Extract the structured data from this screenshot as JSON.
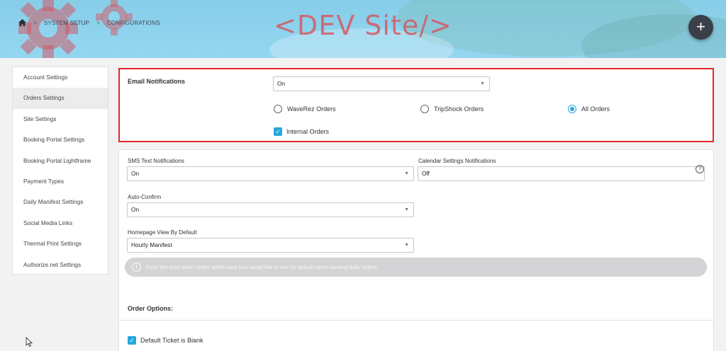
{
  "header": {
    "breadcrumb": [
      "SYSTEM SETUP",
      "CONFIGURATIONS"
    ],
    "dev_title": "<DEV Site/>",
    "add_label": "+"
  },
  "sidebar": {
    "items": [
      {
        "label": "Account Settings"
      },
      {
        "label": "Orders Settings"
      },
      {
        "label": "Site Settings"
      },
      {
        "label": "Booking Portal Settings"
      },
      {
        "label": "Booking Portal Lightframe"
      },
      {
        "label": "Payment Types"
      },
      {
        "label": "Daily Manifest Settings"
      },
      {
        "label": "Social Media Links"
      },
      {
        "label": "Thermal Print Settings"
      },
      {
        "label": "Authorize.net Settings"
      }
    ],
    "active": "Orders Settings"
  },
  "email": {
    "label": "Email Notifications",
    "value": "On",
    "radios": [
      {
        "label": "WaveRez Orders",
        "checked": false
      },
      {
        "label": "TripShock Orders",
        "checked": false
      },
      {
        "label": "All Orders",
        "checked": true
      }
    ],
    "internal_label": "Internal Orders",
    "internal_checked": true
  },
  "sms": {
    "label": "SMS Text Notifications",
    "value": "On"
  },
  "calendar": {
    "label": "Calendar Settings Notifications",
    "value": "Off"
  },
  "auto_confirm": {
    "label": "Auto-Confirm",
    "value": "On"
  },
  "homepage": {
    "label": "Homepage View By Default",
    "value": "Hourly Manifest"
  },
  "info_text": "From the drop down select which view you would like to see by default when viewing daily orders.",
  "order_options": {
    "title": "Order Options:",
    "default_ticket_label": "Default Ticket is Blank",
    "default_ticket_checked": true
  },
  "colors": {
    "accent": "#26a7dd",
    "highlight_border": "#e1262a",
    "fab": "#3b3f47"
  }
}
